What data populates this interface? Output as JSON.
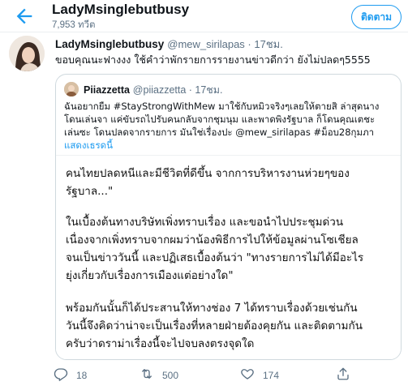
{
  "header": {
    "title": "LadyMsinglebutbusy",
    "tweet_count": "7,953 ทวีต",
    "follow_label": "ติดตาม"
  },
  "tweet": {
    "author_name": "LadyMsinglebutbusy",
    "author_meta": "@mew_sirilapas · 17ชม.",
    "text": "ขอบคุณนะฟางงง ใช้คำว่าพักรายการรายงานข่าวดีกว่า ยังไม่ปลดๆ5555"
  },
  "quote": {
    "author_name": "Piiazzetta",
    "author_meta": "@piiazzetta · 17ชม.",
    "lines": [
      "ฉันอยากยืม #StayStrongWithMew มาใช้กับหมิวจริงๆเลยให้ตายสิ ล่าสุดนาง",
      "โดนเล่นจา แค่ขับรถไปรับคนกลับจากชุมนุม และพาดพิงรัฐบาล ก็โดนคุณเตชะ",
      "เล่นซะ โดนปลดจากรายการ มันใช่เรื่องปะ @mew_sirilapas #ม็อบ28กุมภา"
    ],
    "show_thread": "แสดงเธรดนี้"
  },
  "image_text": {
    "lines": [
      "คนไทยปลดหนีและมีชีวิตที่ดีขึ้น จากการบริหารงานห่วยๆของ",
      "รัฐบาล...\"",
      "ในเบื้องต้นทางบริษัทเพิ่งทราบเรื่อง และขอนำไปประชุมด่วน",
      "เนื่องจากเพิ่งทราบจากผมว่าน้องพิธีการไปให้ข้อมูลผ่านโซเชียล",
      "จนเป็นข่าววันนี้ และปฏิเสธเบื้องต้นว่า \"ทางรายการไม่ได้มีอะไร",
      "ยุ่งเกี่ยวกับเรื่องการเมืองแต่อย่างใด\"",
      "พร้อมกันนั้นก็ได้ประสานให้ทางช่อง 7 ได้ทราบเรื่องด้วยเช่นกัน",
      "วันนี้จึงคิดว่าน่าจะเป็นเรื่องที่หลายฝ่ายต้องคุยกัน และติดตามกัน",
      "ครับว่าดราม่าเรื่องนี้จะไปจบลงตรงจุดใด"
    ]
  },
  "actions": {
    "reply_count": "18",
    "retweet_count": "500",
    "like_count": "174"
  },
  "icons": {
    "back": "arrow-left-icon",
    "reply": "reply-icon",
    "retweet": "retweet-icon",
    "like": "heart-icon",
    "share": "share-icon"
  },
  "colors": {
    "accent": "#1d9bf0",
    "secondary_text": "#5b7083",
    "border": "#cfd9de"
  }
}
